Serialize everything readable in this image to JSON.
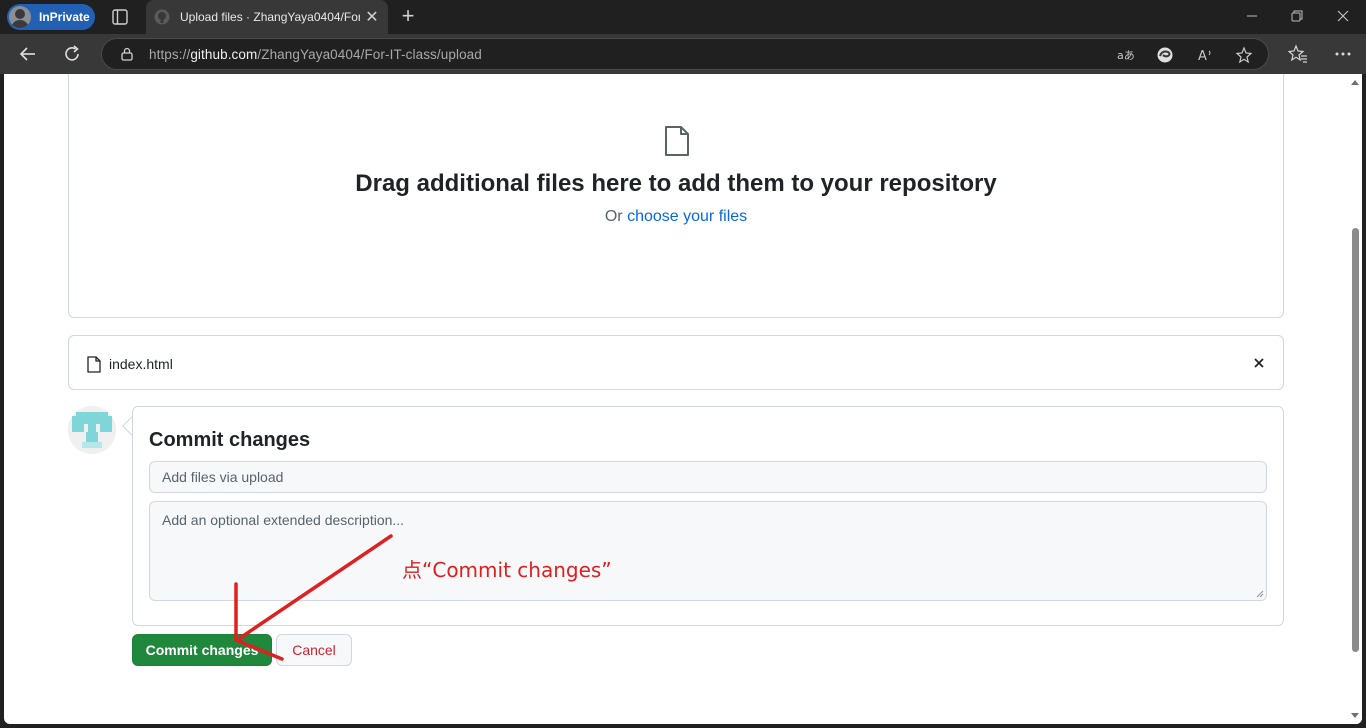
{
  "browser": {
    "inprivate_label": "InPrivate",
    "tab_title": "Upload files · ZhangYaya0404/For-IT-class",
    "url_prefix": "https://",
    "url_host": "github.com",
    "url_path": "/ZhangYaya0404/For-IT-class/upload",
    "new_tab_glyph": "+",
    "tab_close_glyph": "✕"
  },
  "dropzone": {
    "title": "Drag additional files here to add them to your repository",
    "or_text": "Or",
    "choose_link": "choose your files"
  },
  "uploaded_file": {
    "name": "index.html"
  },
  "commit": {
    "heading": "Commit changes",
    "summary_placeholder": "Add files via upload",
    "description_placeholder": "Add an optional extended description...",
    "commit_button": "Commit changes",
    "cancel_button": "Cancel"
  },
  "annotation": {
    "text": "点“Commit changes”",
    "color": "#e02020"
  },
  "colors": {
    "commit_green": "#1f883d",
    "link_blue": "#0969da",
    "cancel_red": "#cf222e",
    "inprivate_blue": "#2260b4"
  }
}
